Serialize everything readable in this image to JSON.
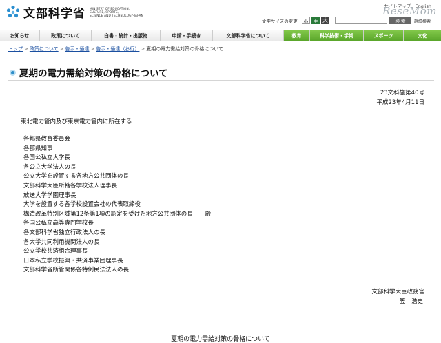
{
  "header": {
    "logo_text": "文部科学省",
    "logo_sub": [
      "MINISTRY OF EDUCATION,",
      "CULTURE, SPORTS,",
      "SCIENCE AND TECHNOLOGY-JAPAN"
    ],
    "top_links": "サイトマップ | English",
    "watermark": "ReseMom",
    "font_size_label": "文字サイズの変更",
    "font_size_small": "小",
    "font_size_mid": "中",
    "font_size_large": "大",
    "search_button": "検 索",
    "advanced_search": "詳細検索"
  },
  "nav": [
    {
      "label": "お知らせ"
    },
    {
      "label": "政策について"
    },
    {
      "label": "白書・統計・出版物"
    },
    {
      "label": "申請・手続き"
    },
    {
      "label": "文部科学省について"
    },
    {
      "label": "教育"
    },
    {
      "label": "科学技術・学術"
    },
    {
      "label": "スポーツ"
    },
    {
      "label": "文化"
    }
  ],
  "breadcrumb": {
    "items": [
      "トップ",
      "政策について",
      "告示・通達",
      "告示・通達（お行）"
    ],
    "current": "夏期の電力需給対策の骨格について",
    "separator": ">"
  },
  "page": {
    "title": "夏期の電力需給対策の骨格について",
    "doc_number": "23文科施第40号",
    "doc_date": "平成23年4月11日",
    "addressee_intro": "東北電力管内及び東京電力管内に所在する",
    "addressees": [
      "各都県教育委員会",
      "各都県知事",
      "各国公私立大学長",
      "各公立大学法人の長",
      "公立大学を設置する各地方公共団体の長",
      "文部科学大臣所轄各学校法人理事長",
      "放送大学学園理事長",
      "大学を設置する各学校設置会社の代表取締役",
      "構造改革特別区域第12条第1項の認定を受けた地方公共団体の長",
      "各国公私立高等専門学校長",
      "各文部科学省独立行政法人の長",
      "各大学共同利用機関法人の長",
      "公立学校共済組合理事長",
      "日本私立学校振興・共済事業団理事長",
      "文部科学省所管関係各特例民法法人の長"
    ],
    "honorific": "殿",
    "sender_title": "文部科学大臣政務官",
    "sender_name": "笠　浩史",
    "doc_heading": "夏期の電力需給対策の骨格について"
  }
}
